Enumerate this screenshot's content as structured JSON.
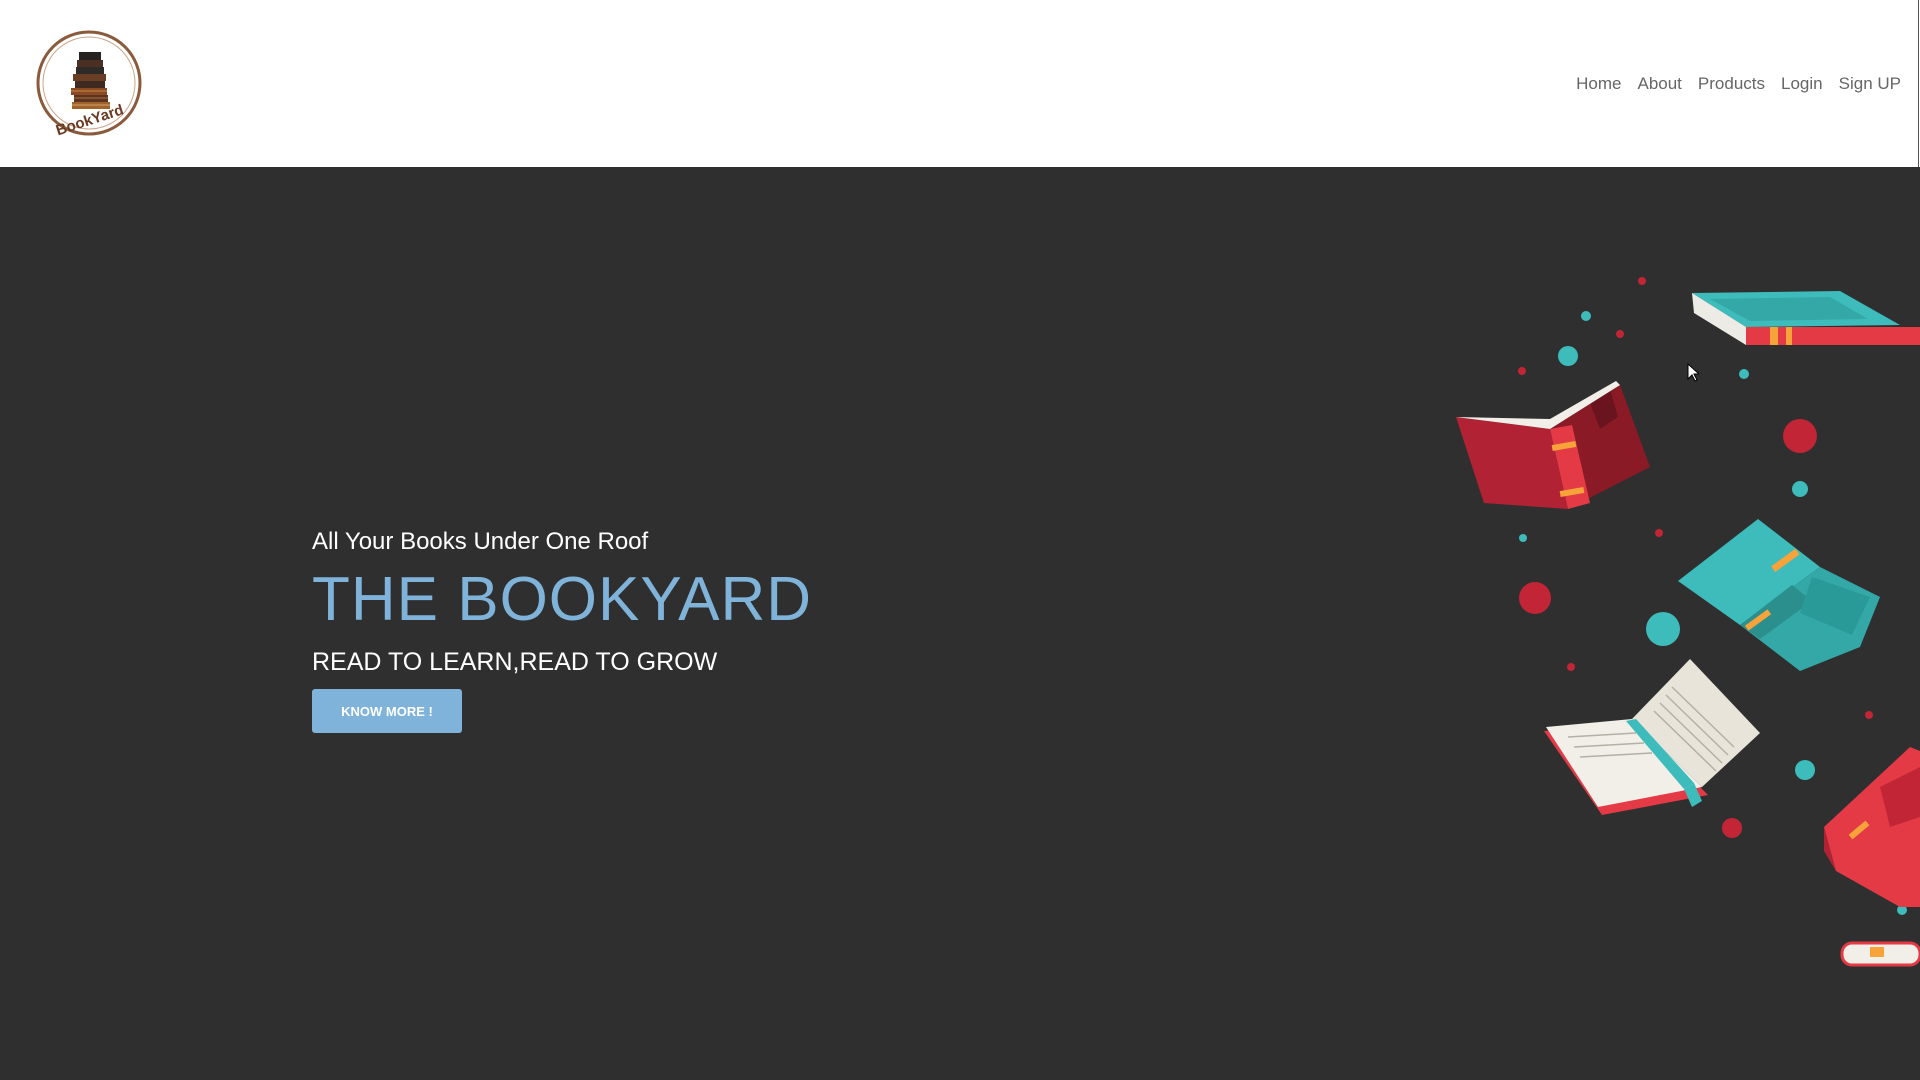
{
  "header": {
    "logo_text": "BookYard",
    "nav": [
      {
        "label": "Home"
      },
      {
        "label": "About"
      },
      {
        "label": "Products"
      },
      {
        "label": "Login"
      },
      {
        "label": "Sign UP"
      }
    ]
  },
  "hero": {
    "tagline": "All Your Books Under One Roof",
    "title": "THE BOOKYARD",
    "subtitle": "READ TO LEARN,READ TO GROW",
    "cta_label": "KNOW MORE !"
  },
  "colors": {
    "accent": "#7fb3d9",
    "hero_bg": "#2f2f2f",
    "nav_text": "#666666",
    "book_red": "#e33a46",
    "book_teal": "#3dbcbb"
  },
  "icons": [
    "bookyard-logo",
    "flying-books-illustration",
    "mouse-cursor-icon"
  ]
}
